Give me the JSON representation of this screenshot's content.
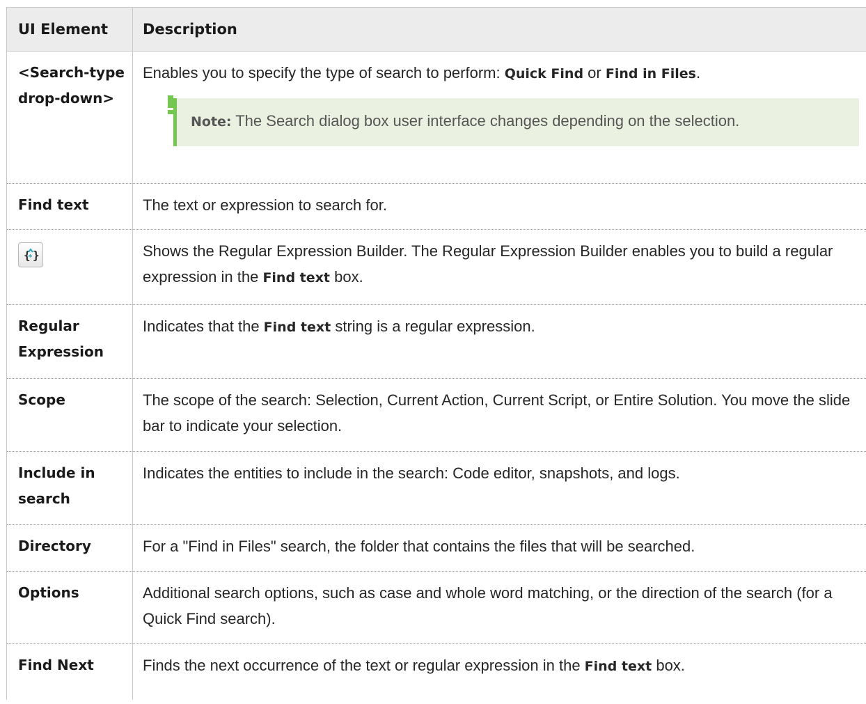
{
  "table": {
    "headers": {
      "element": "UI Element",
      "description": "Description"
    },
    "rows": [
      {
        "element": "<Search-type drop-down>",
        "desc_1": "Enables you to specify the type of search to perform: ",
        "desc_b1": "Quick Find",
        "desc_2": " or ",
        "desc_b2": "Find in Files",
        "desc_3": ".",
        "note_label": "Note:",
        "note_text": " The Search dialog box user interface changes depending on the selection."
      },
      {
        "element": "Find text",
        "desc_1": "The text or expression to search for."
      },
      {
        "element_icon": "regular-expression-builder-icon",
        "desc_1": "Shows the Regular Expression Builder. The Regular Expression Builder enables you to build a regular expression in the ",
        "desc_b1": "Find text",
        "desc_2": " box."
      },
      {
        "element": "Regular Expression",
        "desc_1": "Indicates that the ",
        "desc_b1": "Find text",
        "desc_2": " string is a regular expression."
      },
      {
        "element": "Scope",
        "desc_1": "The scope of the search: Selection, Current Action, Current Script, or Entire Solution. You move the slide bar to indicate your selection."
      },
      {
        "element": "Include in search",
        "desc_1": "Indicates the entities to include in the search: Code editor, snapshots, and logs."
      },
      {
        "element": "Directory",
        "desc_1": "For a \"Find in Files\" search, the folder that contains the files that will be searched."
      },
      {
        "element": "Options",
        "desc_1": "Additional search options, such as case and whole word matching, or the direction of the search (for a Quick Find search)."
      },
      {
        "element": "Find Next",
        "desc_1": "Finds the next occurrence of the text or regular expression in the ",
        "desc_b1": "Find text",
        "desc_2": " box."
      }
    ]
  },
  "colors": {
    "header_bg": "#ececec",
    "note_bg": "#eaf1e1",
    "note_accent": "#74c850"
  }
}
